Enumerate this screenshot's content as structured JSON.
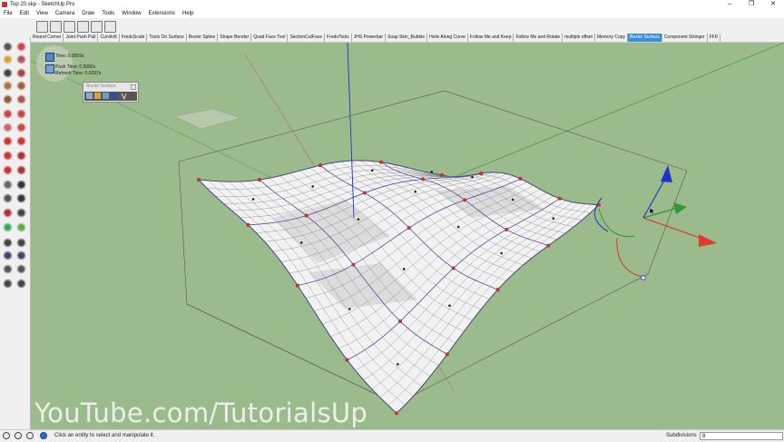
{
  "window": {
    "title": "Top 20.skp - SketchUp Pro",
    "controls": {
      "minimize": "–",
      "maximize": "❐",
      "close": "✕"
    }
  },
  "menu": [
    "File",
    "Edit",
    "View",
    "Camera",
    "Draw",
    "Tools",
    "Window",
    "Extensions",
    "Help"
  ],
  "plugins_toolbar": {
    "tabs": [
      "Round Corner",
      "Joint Push Pull",
      "Curviloft",
      "FredoScale",
      "Tools On Surface",
      "Bezier Spline",
      "Shape Bender",
      "Quad Face Tool",
      "SectionCutFace",
      "FredoTools",
      "JHS Powerbar",
      "Soap Skin_Bubble",
      "Helix Along Curve",
      "Follow Me and Keep",
      "Follow Me and Rotate",
      "multiple offset",
      "Memory Copy",
      "Bezier Surface",
      "Component Stringer",
      "FFD"
    ],
    "active_tab": "Bezier Surface"
  },
  "info_overlay": {
    "line1": "Time: 0.0059s",
    "line2": "Push Time: 0.0082s",
    "line3": "Refresh Time: 0.0297s"
  },
  "bezier_panel": {
    "title": "Bezier Surface"
  },
  "watermark": "YouTube.com/TutorialsUp",
  "status": {
    "hint": "Click an entity to select and manipulate it.",
    "measurement_label": "Subdivisions",
    "measurement_value": "8"
  },
  "colors": {
    "viewport_bg": "#9bbb8d",
    "active_tab": "#3b8fd8",
    "axis_red": "#e03a2a",
    "axis_green": "#2e9a2e",
    "axis_blue": "#2233cc"
  },
  "icons": {
    "left_tools": [
      "select-icon",
      "eraser-icon",
      "paint-bucket-icon",
      "eraser-alt-icon",
      "line-icon",
      "freehand-icon",
      "rectangle-icon",
      "rotated-rectangle-icon",
      "circle-icon",
      "polygon-icon",
      "arc-icon",
      "two-point-arc-icon",
      "pie-icon",
      "three-point-arc-icon",
      "move-icon",
      "push-pull-icon",
      "rotate-icon",
      "follow-me-icon",
      "scale-icon",
      "offset-icon",
      "tape-measure-icon",
      "text-icon",
      "protractor-icon",
      "dimension-icon",
      "axes-icon",
      "3d-text-icon",
      "orbit-icon",
      "pan-icon",
      "zoom-icon",
      "zoom-window-icon",
      "zoom-extents-icon",
      "previous-view-icon",
      "walk-icon",
      "look-around-icon",
      "position-camera-icon",
      "section-plane-icon"
    ],
    "top_tools": [
      "components-icon",
      "materials-icon",
      "warehouse-icon",
      "extension-warehouse-icon",
      "layout-icon",
      "model-info-icon"
    ]
  }
}
